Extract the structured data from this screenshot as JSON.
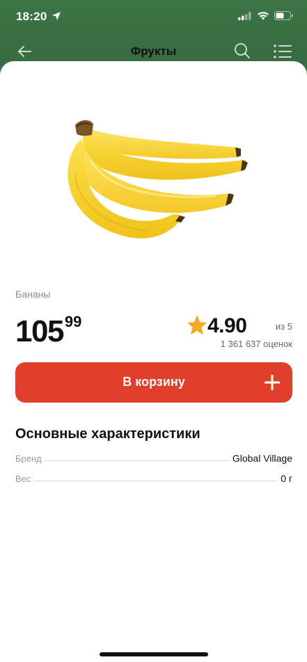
{
  "status_bar": {
    "time": "18:20"
  },
  "nav": {
    "title": "Фрукты"
  },
  "product": {
    "name": "Бананы",
    "price_main": "105",
    "price_cents": "99",
    "rating_value": "4.90",
    "rating_of": "из 5",
    "rating_count": "1 361 637 оценок",
    "image_icon": "banana-bunch"
  },
  "cart": {
    "label": "В корзину"
  },
  "specs": {
    "title": "Основные характеристики",
    "rows": [
      {
        "key": "Бренд",
        "value": "Global Village"
      },
      {
        "key": "Вес",
        "value": "0 г"
      }
    ]
  },
  "colors": {
    "header": "#3d7446",
    "accent": "#e0402a",
    "star": "#f5a623"
  }
}
